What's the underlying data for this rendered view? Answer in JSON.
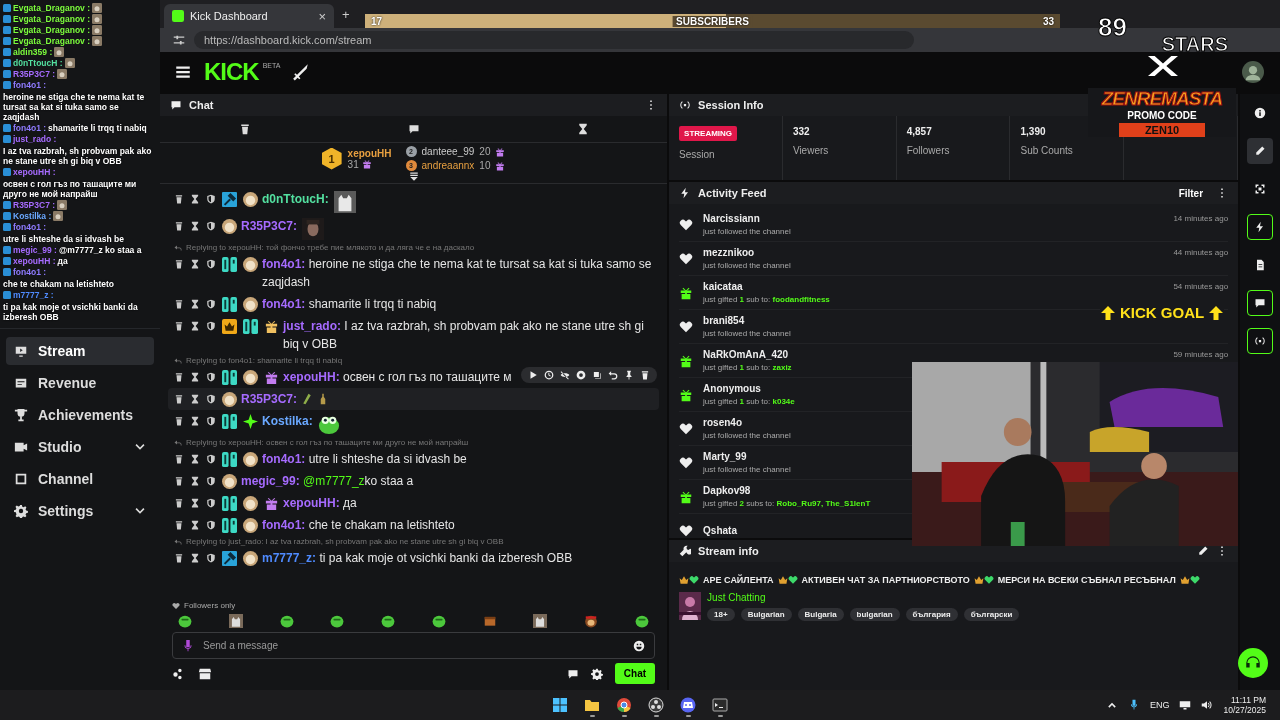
{
  "overlay_chat": [
    {
      "user": "Evgata_Draganov :",
      "color": "#7cfc3c"
    },
    {
      "user": "Evgata_Draganov :",
      "color": "#7cfc3c"
    },
    {
      "user": "Evgata_Draganov :",
      "color": "#7cfc3c"
    },
    {
      "user": "Evgata_Draganov :",
      "color": "#7cfc3c"
    },
    {
      "user": "aldin359 :",
      "color": "#7cfc3c"
    },
    {
      "user": "d0nTtoucH :",
      "color": "#53e0a0"
    },
    {
      "user": "R35P3C7 :",
      "color": "#a66bff"
    },
    {
      "user": "fon4o1 :",
      "color": "#8f7bff",
      "text": "heroine ne stiga che te nema kat te tursat sa kat si tuka samo se zaqjdash"
    },
    {
      "user": "fon4o1 :",
      "color": "#8f7bff",
      "text": "shamarite li trqq ti nabiq"
    },
    {
      "user": "just_rado :",
      "color": "#a66bff",
      "text": "I az tva razbrah, sh probvam pak ako ne stane utre sh gi biq v OBB"
    },
    {
      "user": "xepouHH :",
      "color": "#a66bff",
      "text": "освен с гол гъз по ташаците ми друго не мой напрайш"
    },
    {
      "user": "R35P3C7 :",
      "color": "#a66bff"
    },
    {
      "user": "Kostilka :",
      "color": "#6aa8ff"
    },
    {
      "user": "fon4o1 :",
      "color": "#8f7bff",
      "text": "utre li shteshe da si idvash be"
    },
    {
      "user": "megic_99 :",
      "color": "#a66bff",
      "text": "@m7777_z ko staa a"
    },
    {
      "user": "xepouHH :",
      "color": "#a66bff",
      "text": "да"
    },
    {
      "user": "fon4o1 :",
      "color": "#8f7bff",
      "text": "che te chakam na letishteto"
    },
    {
      "user": "m7777_z :",
      "color": "#4f8bff",
      "text": "ti pa kak moje ot vsichki banki da izberesh OBB"
    }
  ],
  "sidebar": {
    "items": [
      {
        "label": "Stream",
        "selected": true,
        "expandable": false
      },
      {
        "label": "Revenue",
        "selected": false,
        "expandable": false
      },
      {
        "label": "Achievements",
        "selected": false,
        "expandable": false
      },
      {
        "label": "Studio",
        "selected": false,
        "expandable": true
      },
      {
        "label": "Channel",
        "selected": false,
        "expandable": false
      },
      {
        "label": "Settings",
        "selected": false,
        "expandable": true
      }
    ]
  },
  "browser": {
    "tab": {
      "title": "Kick Dashboard",
      "close": "×"
    },
    "new_tab": "+",
    "url": "https://dashboard.kick.com/stream"
  },
  "header": {
    "logo": "KICK",
    "logo_tag": "BETA"
  },
  "subscriber_goal": {
    "current": "17",
    "label": "SUBSCRIBERS",
    "target": "33",
    "level": 0.52
  },
  "stars_logo": {
    "number": "89",
    "word": "STARS"
  },
  "promo_logo": {
    "title": "ZENREMASTA",
    "label": "PROMO CODE",
    "code": "ZEN10"
  },
  "kick_goal": {
    "label": "KICK GOAL"
  },
  "chat": {
    "title": "Chat",
    "leaderboard": [
      {
        "rank": "1",
        "user": "xepouHH",
        "count": "31"
      },
      {
        "rank": "2",
        "user": "danteee_99",
        "count": "20"
      },
      {
        "rank": "3",
        "user": "andreaannx",
        "count": "10"
      }
    ],
    "messages": [
      {
        "user": "d0nTtoucH:",
        "color": "#53e0a0",
        "badges": [
          {
            "kind": "mod"
          },
          {
            "kind": "avatar"
          }
        ],
        "emotes": [
          {
            "kind": "cat"
          }
        ],
        "selected": false
      },
      {
        "user": "R35P3C7:",
        "color": "#a66bff",
        "badges": [
          {
            "kind": "avatar"
          }
        ],
        "emotes": [
          {
            "kind": "face"
          }
        ],
        "selected": false
      },
      {
        "reply": "Replying to xepouHH: той фончо требе пие млякото и да ляга че е на даскало",
        "user": "fon4o1:",
        "color": "#a66bff",
        "badges": [
          {
            "kind": "og"
          },
          {
            "kind": "avatar"
          }
        ],
        "text": "heroine ne stiga che te nema kat te tursat sa kat si tuka samo se zaqjdash",
        "selected": false
      },
      {
        "user": "fon4o1:",
        "color": "#a66bff",
        "badges": [
          {
            "kind": "og"
          },
          {
            "kind": "avatar"
          }
        ],
        "text": "shamarite li trqq ti nabiq",
        "selected": false
      },
      {
        "user": "just_rado:",
        "color": "#a66bff",
        "badges": [
          {
            "kind": "vip"
          },
          {
            "kind": "og"
          },
          {
            "kind": "giftgold"
          }
        ],
        "text": "I az tva razbrah, sh probvam pak ako ne stane utre sh gi biq v OBB",
        "selected": false
      },
      {
        "reply": "Replying to fon4o1: shamarite li trqq ti nabiq",
        "user": "xepouHH:",
        "color": "#a66bff",
        "badges": [
          {
            "kind": "og"
          },
          {
            "kind": "avatar"
          },
          {
            "kind": "gift"
          }
        ],
        "text": "освен с гол гъз по ташаците м",
        "selected": false
      },
      {
        "user": "R35P3C7:",
        "color": "#a66bff",
        "badges": [
          {
            "kind": "avatar"
          }
        ],
        "emotes": [
          {
            "kind": "money"
          },
          {
            "kind": "bottle"
          }
        ],
        "selected": true
      },
      {
        "user": "Kostilka:",
        "color": "#6aa8ff",
        "badges": [
          {
            "kind": "og"
          },
          {
            "kind": "sparkle"
          }
        ],
        "emotes": [
          {
            "kind": "frog"
          }
        ],
        "selected": false
      },
      {
        "reply": "Replying to xepouHH: освен с гол гъз по ташаците ми друго не мой напрайш",
        "user": "fon4o1:",
        "color": "#a66bff",
        "badges": [
          {
            "kind": "og"
          },
          {
            "kind": "avatar"
          }
        ],
        "text": "utre li shteshe da si idvash be",
        "selected": false
      },
      {
        "user": "megic_99:",
        "color": "#a66bff",
        "badges": [
          {
            "kind": "avatar"
          }
        ],
        "mention": "@m7777_z",
        "text": "ko staa a",
        "selected": false
      },
      {
        "user": "xepouHH:",
        "color": "#a66bff",
        "badges": [
          {
            "kind": "og"
          },
          {
            "kind": "avatar"
          },
          {
            "kind": "gift"
          }
        ],
        "text": "да",
        "selected": false
      },
      {
        "user": "fon4o1:",
        "color": "#a66bff",
        "badges": [
          {
            "kind": "og"
          },
          {
            "kind": "avatar"
          }
        ],
        "text": "che te chakam na letishteto",
        "selected": false
      },
      {
        "reply": "Replying to just_rado: I az tva razbrah, sh probvam pak ako ne stane utre sh gi biq v OBB",
        "user": "m7777_z:",
        "color": "#4f8bff",
        "badges": [
          {
            "kind": "mod"
          },
          {
            "kind": "avatar"
          }
        ],
        "text": "ti pa kak moje ot vsichki banki da izberesh OBB",
        "selected": false
      }
    ],
    "mode": "Followers only",
    "emote_bar": [
      {
        "kind": "frog"
      },
      {
        "kind": "cat"
      },
      {
        "kind": "frog"
      },
      {
        "kind": "frog"
      },
      {
        "kind": "frog"
      },
      {
        "kind": "frog"
      },
      {
        "kind": "box"
      },
      {
        "kind": "cat"
      },
      {
        "kind": "monkey"
      },
      {
        "kind": "frog"
      }
    ],
    "input": {
      "placeholder": "Send a message"
    },
    "send_button": "Chat"
  },
  "session_info": {
    "title": "Session Info",
    "status": "STREAMING",
    "stats": [
      {
        "label": "Session"
      },
      {
        "value": "332",
        "label": "Viewers"
      },
      {
        "value": "4,857",
        "label": "Followers"
      },
      {
        "value": "1,390",
        "label": "Sub Counts"
      }
    ]
  },
  "activity_feed": {
    "title": "Activity Feed",
    "filter": "Filter",
    "items": [
      {
        "kind": "follow",
        "name": "Narcissiann",
        "detail": "just followed the channel",
        "time": "14 minutes ago"
      },
      {
        "kind": "follow",
        "name": "mezznikoo",
        "detail": "just followed the channel",
        "time": "44 minutes ago"
      },
      {
        "kind": "gift",
        "name": "kaicataa",
        "detail": "just gifted",
        "count": "1",
        "unit": "sub to:",
        "recipients": "foodandfitness",
        "time": "54 minutes ago"
      },
      {
        "kind": "follow",
        "name": "brani854",
        "detail": "just followed the channel"
      },
      {
        "kind": "gift",
        "name": "NaRkOmAnA_420",
        "detail": "just gifted",
        "count": "1",
        "unit": "sub to:",
        "recipients": "zaxiz",
        "time": "59 minutes ago"
      },
      {
        "kind": "gift",
        "name": "Anonymous",
        "detail": "just gifted",
        "count": "1",
        "unit": "sub to:",
        "recipients": "k034e"
      },
      {
        "kind": "follow",
        "name": "rosen4o",
        "detail": "just followed the channel"
      },
      {
        "kind": "follow",
        "name": "Marty_99",
        "detail": "just followed the channel"
      },
      {
        "kind": "gift",
        "name": "Dapkov98",
        "detail": "just gifted",
        "count": "2",
        "unit": "subs to:",
        "recipients": "Robo_Ru97, The_S1lenT"
      },
      {
        "kind": "follow",
        "name": "Qshata"
      }
    ]
  },
  "stream_info": {
    "title": "Stream info",
    "stream_title": [
      "АРЕ САЙЛЕНТА",
      "АКТИВЕН ЧАТ ЗА ПАРТНИОРСТВОТО",
      "МЕРСИ НА ВСЕКИ СЪБНАЛ РЕСЪБНАЛ"
    ],
    "category": "Just Chatting",
    "tags": [
      "18+",
      "Bulgarian",
      "Bulgaria",
      "bulgarian",
      "българия",
      "български"
    ]
  },
  "rail": [
    {
      "kind": "info",
      "active": false,
      "selected": false
    },
    {
      "kind": "pencil",
      "active": false,
      "selected": true
    },
    {
      "kind": "capture",
      "active": false,
      "selected": false
    },
    {
      "kind": "bolt",
      "active": true,
      "selected": false
    },
    {
      "kind": "doc",
      "active": false,
      "selected": false
    },
    {
      "kind": "chat",
      "active": true,
      "selected": false
    },
    {
      "kind": "broadcast",
      "active": true,
      "selected": false
    }
  ],
  "taskbar": {
    "apps": [
      {
        "kind": "start",
        "running": false
      },
      {
        "kind": "folder",
        "running": true
      },
      {
        "kind": "browser",
        "running": true
      },
      {
        "kind": "obs",
        "running": true
      },
      {
        "kind": "discord",
        "running": true
      },
      {
        "kind": "terminal",
        "running": true
      }
    ],
    "language": "ENG",
    "time": "11:11 PM",
    "date": "10/27/2025"
  }
}
